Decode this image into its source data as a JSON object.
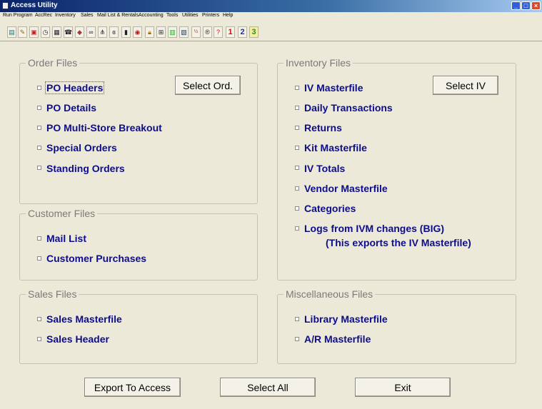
{
  "window": {
    "title": "Access Utility"
  },
  "menu": [
    "Run Program",
    "AccRec",
    "Inventory",
    "Sales",
    "Mail List & Rentals",
    "Accounting",
    "Tools",
    "Utilities",
    "Printers",
    "Help"
  ],
  "toolbar": {
    "icons": [
      "book-icon",
      "notes-icon",
      "printer-icon",
      "clock-icon",
      "calculator-icon",
      "phone-icon",
      "tag-icon",
      "binoculars-icon",
      "tree-icon",
      "glasses-icon",
      "barcode-icon",
      "record-icon",
      "lock-icon",
      "chart-icon",
      "bar-chart-icon",
      "image-icon",
      "fraction-icon",
      "r-icon",
      "help-icon"
    ],
    "help_glyph": "?",
    "numbers": [
      "1",
      "2",
      "3"
    ]
  },
  "order_files": {
    "title": "Order Files",
    "items": [
      "PO Headers",
      "PO Details",
      "PO Multi-Store Breakout",
      "Special Orders",
      "Standing Orders"
    ],
    "select_button": "Select Ord."
  },
  "customer_files": {
    "title": "Customer Files",
    "items": [
      "Mail List",
      "Customer Purchases"
    ]
  },
  "sales_files": {
    "title": "Sales Files",
    "items": [
      "Sales Masterfile",
      "Sales Header"
    ]
  },
  "inventory_files": {
    "title": "Inventory Files",
    "items": [
      "IV Masterfile",
      "Daily Transactions",
      "Returns",
      "Kit Masterfile",
      "IV Totals",
      "Vendor Masterfile",
      "Categories",
      "Logs from IVM changes (BIG)"
    ],
    "note": "(This exports the IV Masterfile)",
    "select_button": "Select IV"
  },
  "misc_files": {
    "title": "Miscellaneous Files",
    "items": [
      "Library Masterfile",
      "A/R Masterfile"
    ]
  },
  "actions": {
    "export": "Export To Access",
    "select_all": "Select All",
    "exit": "Exit"
  },
  "colors": {
    "label": "#0d0d8c",
    "group_title": "#7a7a7a",
    "background": "#ece9d8"
  }
}
